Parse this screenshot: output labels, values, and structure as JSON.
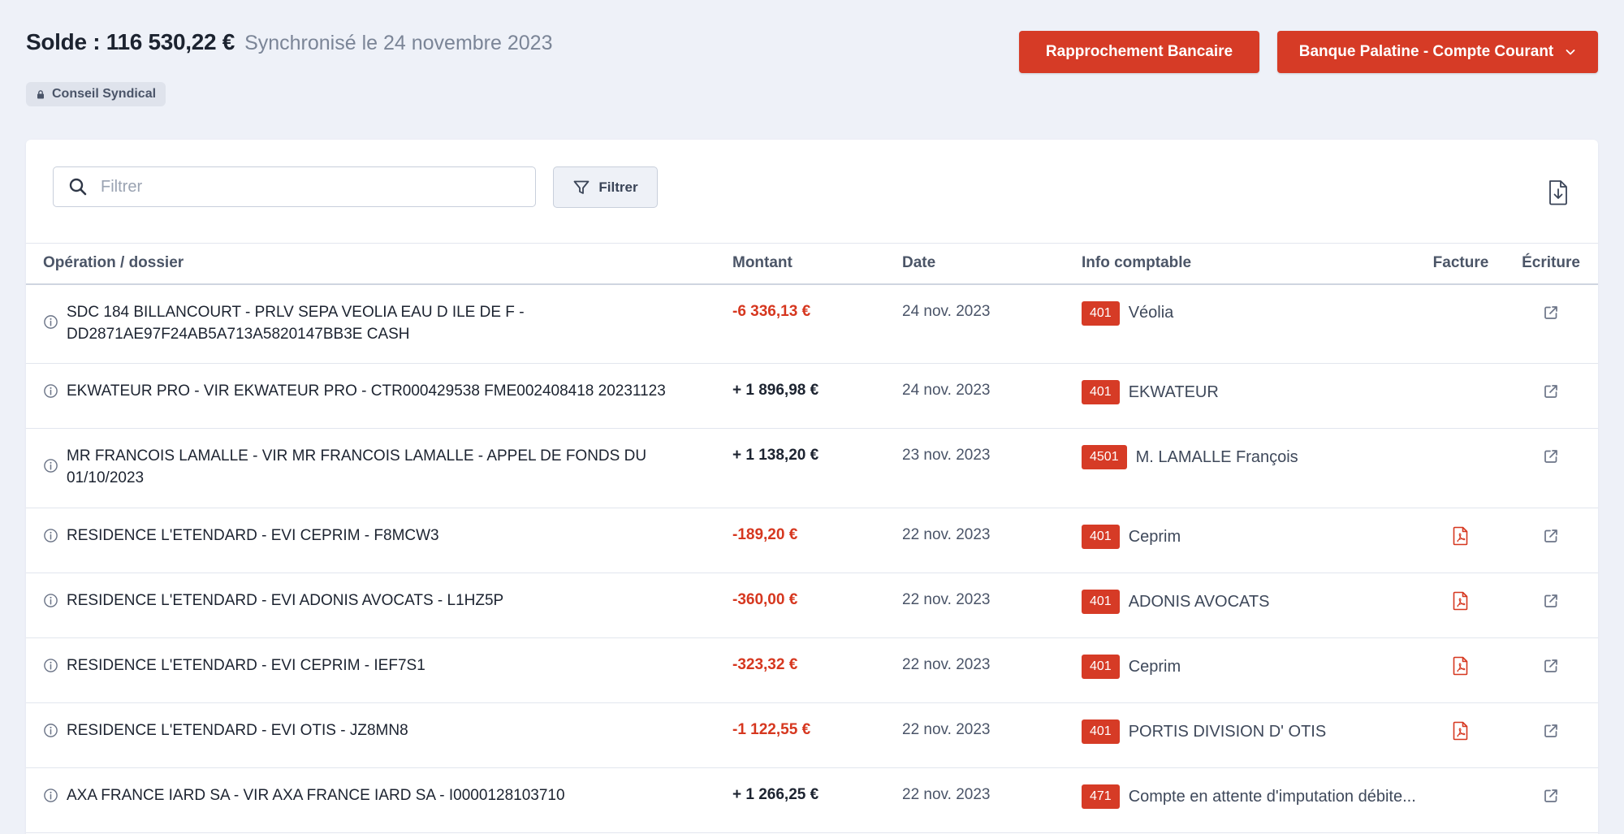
{
  "header": {
    "balance": "Solde : 116 530,22 €",
    "sync": "Synchronisé le 24 novembre 2023",
    "badge": "Conseil Syndical",
    "rappro_btn": "Rapprochement Bancaire",
    "bank_btn": "Banque Palatine - Compte Courant"
  },
  "toolbar": {
    "search_placeholder": "Filtrer",
    "filter_btn": "Filtrer"
  },
  "table": {
    "columns": {
      "operation": "Opération / dossier",
      "amount": "Montant",
      "date": "Date",
      "info": "Info comptable",
      "invoice": "Facture",
      "entry": "Écriture"
    },
    "rows": [
      {
        "op": "SDC 184 BILLANCOURT - PRLV SEPA VEOLIA EAU D ILE DE F - DD2871AE97F24AB5A713A5820147BB3E CASH",
        "amount": "-6 336,13 €",
        "sign": "neg",
        "date": "24 nov. 2023",
        "code": "401",
        "account": "Véolia",
        "invoice": false
      },
      {
        "op": "EKWATEUR PRO - VIR EKWATEUR PRO - CTR000429538 FME002408418 20231123",
        "amount": "+ 1 896,98 €",
        "sign": "pos",
        "date": "24 nov. 2023",
        "code": "401",
        "account": "EKWATEUR",
        "invoice": false
      },
      {
        "op": "MR FRANCOIS LAMALLE - VIR MR FRANCOIS LAMALLE - APPEL DE FONDS DU 01/10/2023",
        "amount": "+ 1 138,20 €",
        "sign": "pos",
        "date": "23 nov. 2023",
        "code": "4501",
        "account": "M. LAMALLE François",
        "invoice": false
      },
      {
        "op": "RESIDENCE L'ETENDARD - EVI CEPRIM - F8MCW3",
        "amount": "-189,20 €",
        "sign": "neg",
        "date": "22 nov. 2023",
        "code": "401",
        "account": "Ceprim",
        "invoice": true
      },
      {
        "op": "RESIDENCE L'ETENDARD - EVI ADONIS AVOCATS - L1HZ5P",
        "amount": "-360,00 €",
        "sign": "neg",
        "date": "22 nov. 2023",
        "code": "401",
        "account": "ADONIS AVOCATS",
        "invoice": true
      },
      {
        "op": "RESIDENCE L'ETENDARD - EVI CEPRIM - IEF7S1",
        "amount": "-323,32 €",
        "sign": "neg",
        "date": "22 nov. 2023",
        "code": "401",
        "account": "Ceprim",
        "invoice": true
      },
      {
        "op": "RESIDENCE L'ETENDARD - EVI OTIS - JZ8MN8",
        "amount": "-1 122,55 €",
        "sign": "neg",
        "date": "22 nov. 2023",
        "code": "401",
        "account": "PORTIS DIVISION D' OTIS",
        "invoice": true
      },
      {
        "op": "AXA FRANCE IARD SA - VIR AXA FRANCE IARD SA - I0000128103710",
        "amount": "+ 1 266,25 €",
        "sign": "pos",
        "date": "22 nov. 2023",
        "code": "471",
        "account": "Compte en attente d'imputation débite...",
        "invoice": false
      }
    ]
  },
  "colors": {
    "accent": "#d63b26",
    "negative": "#d6371f",
    "background": "#eef1f8"
  },
  "icons": {
    "badge": "lock-icon",
    "bank_dropdown": "chevron-down-icon",
    "search": "search-icon",
    "filter": "funnel-icon",
    "export": "file-download-icon",
    "row_info": "info-icon",
    "invoice": "pdf-icon",
    "entry": "external-link-icon"
  }
}
